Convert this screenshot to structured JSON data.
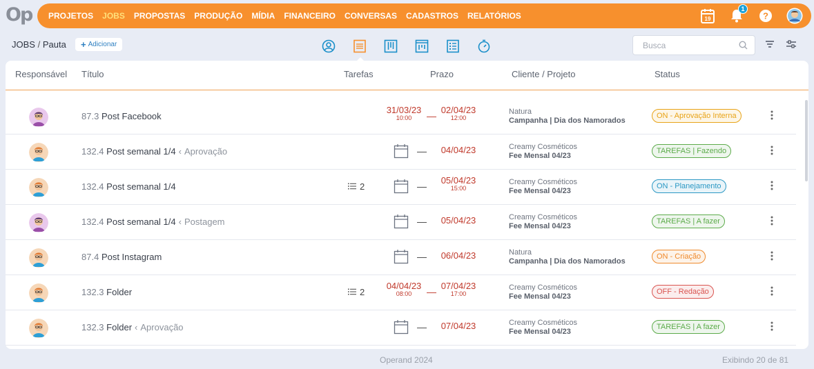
{
  "app": {
    "logo": "Op"
  },
  "nav": {
    "items": [
      {
        "label": "PROJETOS",
        "active": false
      },
      {
        "label": "JOBS",
        "active": true
      },
      {
        "label": "PROPOSTAS",
        "active": false
      },
      {
        "label": "PRODUÇÃO",
        "active": false
      },
      {
        "label": "MÍDIA",
        "active": false
      },
      {
        "label": "FINANCEIRO",
        "active": false
      },
      {
        "label": "CONVERSAS",
        "active": false
      },
      {
        "label": "CADASTROS",
        "active": false
      },
      {
        "label": "RELATÓRIOS",
        "active": false
      }
    ],
    "calendar_day": "19",
    "notification_count": "1"
  },
  "breadcrumb": {
    "section": "JOBS",
    "separator": "/",
    "page": "Pauta"
  },
  "toolbar": {
    "add_label": "Adicionar",
    "search_placeholder": "Busca"
  },
  "table": {
    "headers": {
      "responsible": "Responsável",
      "title": "Título",
      "tasks": "Tarefas",
      "deadline": "Prazo",
      "client": "Cliente / Projeto",
      "status": "Status"
    },
    "rows": [
      {
        "avatar": "purple",
        "num": "87.3",
        "name": "Post Facebook",
        "sub": "",
        "tasks": "",
        "start_date": "31/03/23",
        "start_time": "10:00",
        "end_date": "02/04/23",
        "end_time": "12:00",
        "client": "Natura",
        "project": "Campanha | Dia dos Namorados",
        "status": "ON - Aprovação Interna",
        "status_color": "#e8a317"
      },
      {
        "avatar": "orange",
        "num": "132.4",
        "name": "Post semanal 1/4",
        "sub": "Aprovação",
        "tasks": "",
        "start_date": "",
        "start_time": "",
        "end_date": "04/04/23",
        "end_time": "",
        "client": "Creamy Cosméticos",
        "project": "Fee Mensal 04/23",
        "status": "TAREFAS | Fazendo",
        "status_color": "#5cab4a"
      },
      {
        "avatar": "orange",
        "num": "132.4",
        "name": "Post semanal 1/4",
        "sub": "",
        "tasks": "2",
        "start_date": "",
        "start_time": "",
        "end_date": "05/04/23",
        "end_time": "15:00",
        "client": "Creamy Cosméticos",
        "project": "Fee Mensal 04/23",
        "status": "ON - Planejamento",
        "status_color": "#2b98c4"
      },
      {
        "avatar": "purple",
        "num": "132.4",
        "name": "Post semanal 1/4",
        "sub": "Postagem",
        "tasks": "",
        "start_date": "",
        "start_time": "",
        "end_date": "05/04/23",
        "end_time": "",
        "client": "Creamy Cosméticos",
        "project": "Fee Mensal 04/23",
        "status": "TAREFAS | A fazer",
        "status_color": "#5cab4a"
      },
      {
        "avatar": "orange",
        "num": "87.4",
        "name": "Post Instagram",
        "sub": "",
        "tasks": "",
        "start_date": "",
        "start_time": "",
        "end_date": "06/04/23",
        "end_time": "",
        "client": "Natura",
        "project": "Campanha | Dia dos Namorados",
        "status": "ON - Criação",
        "status_color": "#ef8a2c"
      },
      {
        "avatar": "orange",
        "num": "132.3",
        "name": "Folder",
        "sub": "",
        "tasks": "2",
        "start_date": "04/04/23",
        "start_time": "08:00",
        "end_date": "07/04/23",
        "end_time": "17:00",
        "client": "Creamy Cosméticos",
        "project": "Fee Mensal 04/23",
        "status": "OFF - Redação",
        "status_color": "#d9534f"
      },
      {
        "avatar": "orange",
        "num": "132.3",
        "name": "Folder",
        "sub": "Aprovação",
        "tasks": "",
        "start_date": "",
        "start_time": "",
        "end_date": "07/04/23",
        "end_time": "",
        "client": "Creamy Cosméticos",
        "project": "Fee Mensal 04/23",
        "status": "TAREFAS | A fazer",
        "status_color": "#5cab4a"
      }
    ]
  },
  "footer": {
    "copyright": "Operand 2024",
    "count": "Exibindo 20 de 81"
  },
  "colors": {
    "accent": "#f7902d",
    "active_nav": "#ffe07a",
    "view_icon": "#1a8fc9",
    "date_red": "#c0392b"
  }
}
